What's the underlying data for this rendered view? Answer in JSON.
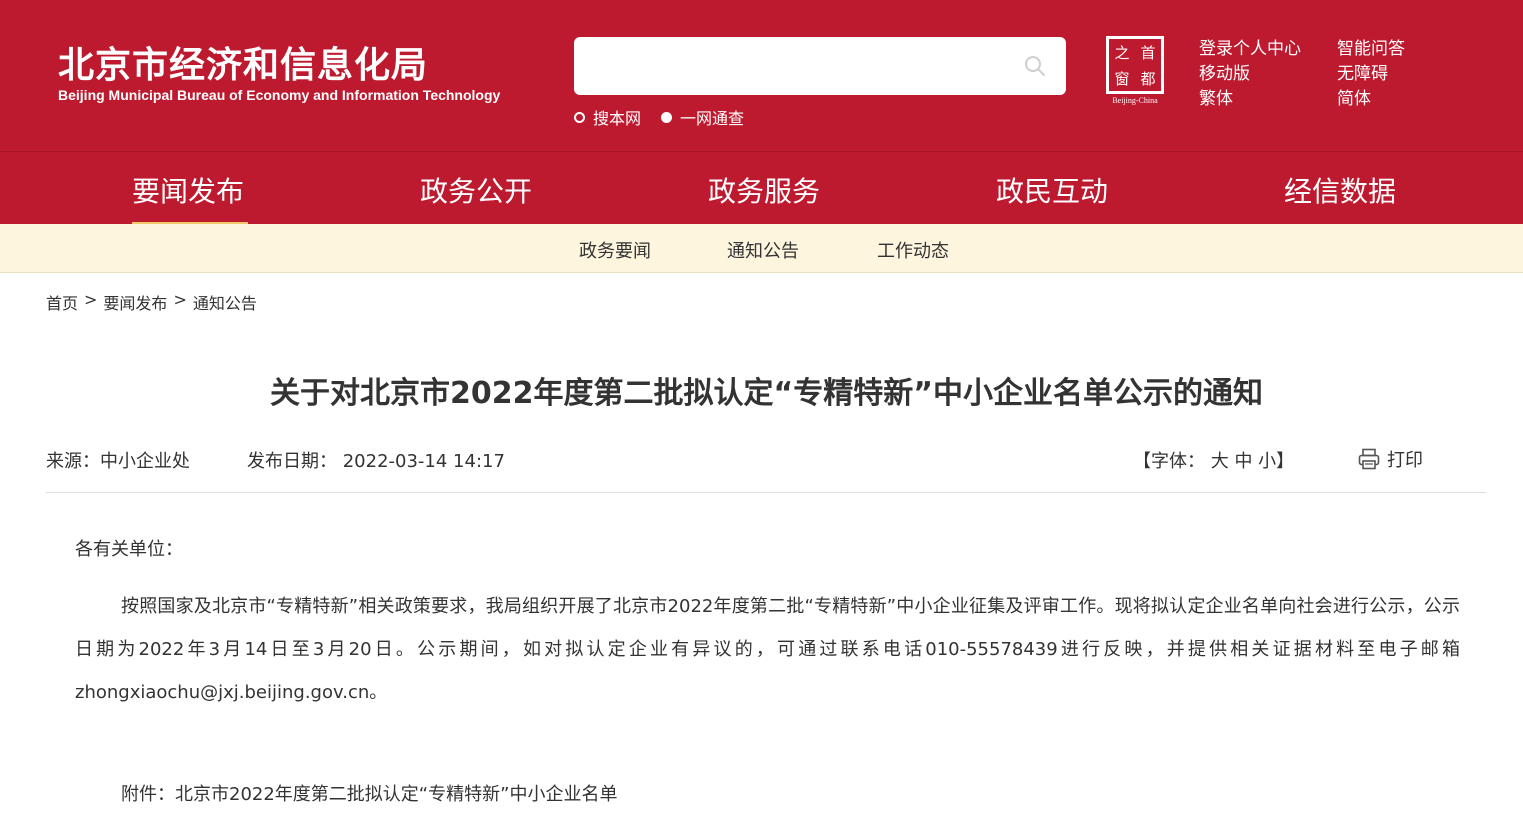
{
  "header": {
    "logo_cn": "北京市经济和信息化局",
    "logo_en": "Beijing Municipal Bureau of Economy and Information Technology",
    "search": {
      "placeholder": "",
      "scope_site": "搜本网",
      "scope_all": "一网通查"
    },
    "seal": {
      "chars": [
        "之",
        "首",
        "窗",
        "都"
      ],
      "subtitle": "Beijing-China"
    },
    "links": {
      "login": "登录个人中心",
      "mobile": "移动版",
      "traditional": "繁体",
      "qa": "智能问答",
      "accessible": "无障碍",
      "simplified": "简体"
    }
  },
  "main_nav": [
    "要闻发布",
    "政务公开",
    "政务服务",
    "政民互动",
    "经信数据"
  ],
  "sub_nav": [
    "政务要闻",
    "通知公告",
    "工作动态"
  ],
  "breadcrumb": [
    "首页",
    "要闻发布",
    "通知公告"
  ],
  "article": {
    "title": "关于对北京市2022年度第二批拟认定“专精特新”中小企业名单公示的通知",
    "source": "来源：中小企业处",
    "date": "发布日期： 2022-03-14 14:17",
    "font_size_label": "【字体： 大 中 小】",
    "print_label": "打印",
    "greeting": "各有关单位：",
    "paragraph": "按照国家及北京市“专精特新”相关政策要求，我局组织开展了北京市2022年度第二批“专精特新”中小企业征集及评审工作。现将拟认定企业名单向社会进行公示，公示日期为2022年3月14日至3月20日。公示期间，如对拟认定企业有异议的，可通过联系电话010-55578439进行反映，并提供相关证据材料至电子邮箱zhongxiaochu@jxj.beijing.gov.cn。",
    "attachment": "附件：北京市2022年度第二批拟认定“专精特新”中小企业名单"
  },
  "colors": {
    "brand_red": "#be1a2f",
    "subnav_bg": "#fdf5de",
    "active_underline": "#f2c96b"
  }
}
